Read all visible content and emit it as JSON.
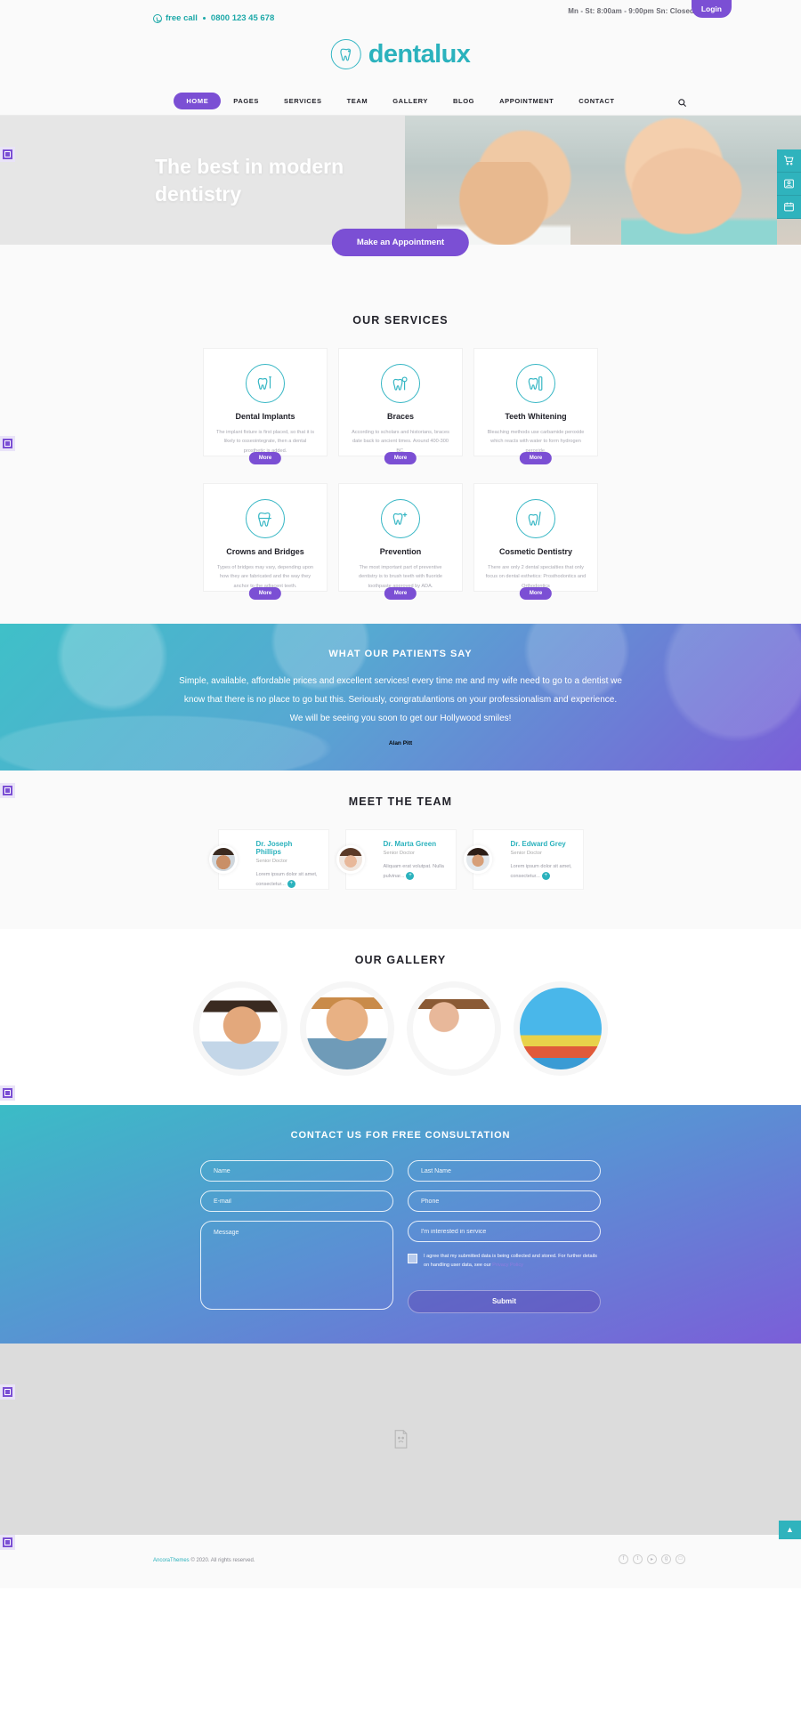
{
  "topbar": {
    "free_call_label": "free call",
    "phone": "0800 123 45 678",
    "hours": "Mn - St: 8:00am - 9:00pm Sn: Closed",
    "login_label": "Login",
    "accent": "#1ca8a8",
    "login_bg": "#7b4fd4"
  },
  "header": {
    "logo_text": "dentalux",
    "logo_icon": "tooth-icon",
    "logo_color": "#2bb2bd"
  },
  "nav": {
    "items": [
      {
        "label": "HOME",
        "active": true
      },
      {
        "label": "PAGES",
        "active": false
      },
      {
        "label": "SERVICES",
        "active": false
      },
      {
        "label": "TEAM",
        "active": false
      },
      {
        "label": "GALLERY",
        "active": false
      },
      {
        "label": "BLOG",
        "active": false
      },
      {
        "label": "APPOINTMENT",
        "active": false
      },
      {
        "label": "CONTACT",
        "active": false
      }
    ],
    "search_icon": "search-icon"
  },
  "hero": {
    "title": "The best in modern dentistry",
    "cta_label": "Make an Appointment"
  },
  "right_dock": [
    {
      "icon": "cart-icon",
      "glyph": "☐"
    },
    {
      "icon": "user-image-icon",
      "glyph": "▣"
    },
    {
      "icon": "calendar-icon",
      "glyph": "▤"
    }
  ],
  "services": {
    "title": "OUR SERVICES",
    "more_label": "More",
    "items": [
      {
        "icon": "tooth-implant-icon",
        "title": "Dental Implants",
        "text": "The implant fixture is first placed, so that it is likely to osseointegrate, then a dental prosthetic is added."
      },
      {
        "icon": "tooth-braces-icon",
        "title": "Braces",
        "text": "According to scholars and historians, braces date back to ancient times. Around 400-300 BC."
      },
      {
        "icon": "tooth-whitening-icon",
        "title": "Teeth Whitening",
        "text": "Bleaching methods use carbamide peroxide which reacts with water to form hydrogen peroxide."
      },
      {
        "icon": "tooth-crown-icon",
        "title": "Crowns and Bridges",
        "text": "Types of bridges may vary, depending upon how they are fabricated and the way they anchor to the adjacent teeth."
      },
      {
        "icon": "tooth-shield-icon",
        "title": "Prevention",
        "text": "The most important part of preventive dentistry is to brush teeth with fluoride toothpaste approved by ADA."
      },
      {
        "icon": "tooth-cosmetic-icon",
        "title": "Cosmetic Dentistry",
        "text": "There are only 2 dental specialties that only focus on dental esthetics: Prosthodontics and Orthodontics"
      }
    ]
  },
  "testimonial": {
    "title": "WHAT OUR PATIENTS SAY",
    "quote": "Simple, available, affordable prices and excellent services! every time me and my wife need to go to a dentist we know that there is no place to go but this. Seriously, congratulantions on your professionalism and experience. We will be seeing you soon to get our Hollywood smiles!",
    "author": "Alan Pitt"
  },
  "team": {
    "title": "MEET THE TEAM",
    "members": [
      {
        "name": "Dr. Joseph Phillips",
        "role": "Senior Doctor",
        "bio": "Lorem ipsum dolor sit amet, consectetur...",
        "avatar": "male-avatar"
      },
      {
        "name": "Dr. Marta Green",
        "role": "Senior Doctor",
        "bio": "Aliquam erat volutpat. Nulla pulvinar...",
        "avatar": "female-avatar"
      },
      {
        "name": "Dr. Edward Grey",
        "role": "Senior Doctor",
        "bio": "Lorem ipsum dolor sit amet, consectetur...",
        "avatar": "male-beard-avatar"
      }
    ]
  },
  "gallery": {
    "title": "OUR GALLERY",
    "items": [
      {
        "alt": "smiling-man-photo"
      },
      {
        "alt": "man-with-glasses-photo"
      },
      {
        "alt": "female-doctor-photo"
      },
      {
        "alt": "laboratory-photo"
      }
    ]
  },
  "contact": {
    "title": "CONTACT US FOR FREE CONSULTATION",
    "fields": {
      "name": {
        "placeholder": "Name",
        "value": ""
      },
      "last_name": {
        "placeholder": "Last Name",
        "value": ""
      },
      "email": {
        "placeholder": "E-mail",
        "value": ""
      },
      "phone": {
        "placeholder": "Phone",
        "value": ""
      },
      "message": {
        "placeholder": "Message",
        "value": ""
      },
      "service": {
        "placeholder": "I'm interested in service",
        "value": ""
      }
    },
    "agree_text": "I agree that my submitted data is being collected and stored. For further details on handling user data, see our",
    "privacy_link": "Privacy Policy",
    "submit_label": "Submit"
  },
  "map": {
    "placeholder_icon": "broken-image-icon"
  },
  "footer": {
    "brand": "AncoraThemes",
    "copyright": "© 2020. All rights reserved.",
    "socials": [
      {
        "icon": "facebook-icon",
        "glyph": "f"
      },
      {
        "icon": "twitter-icon",
        "glyph": "t"
      },
      {
        "icon": "youtube-icon",
        "glyph": "▸"
      },
      {
        "icon": "google-icon",
        "glyph": "g"
      },
      {
        "icon": "instagram-icon",
        "glyph": "□"
      }
    ],
    "to_top_icon": "chevron-up-icon",
    "to_top_glyph": "▲"
  }
}
